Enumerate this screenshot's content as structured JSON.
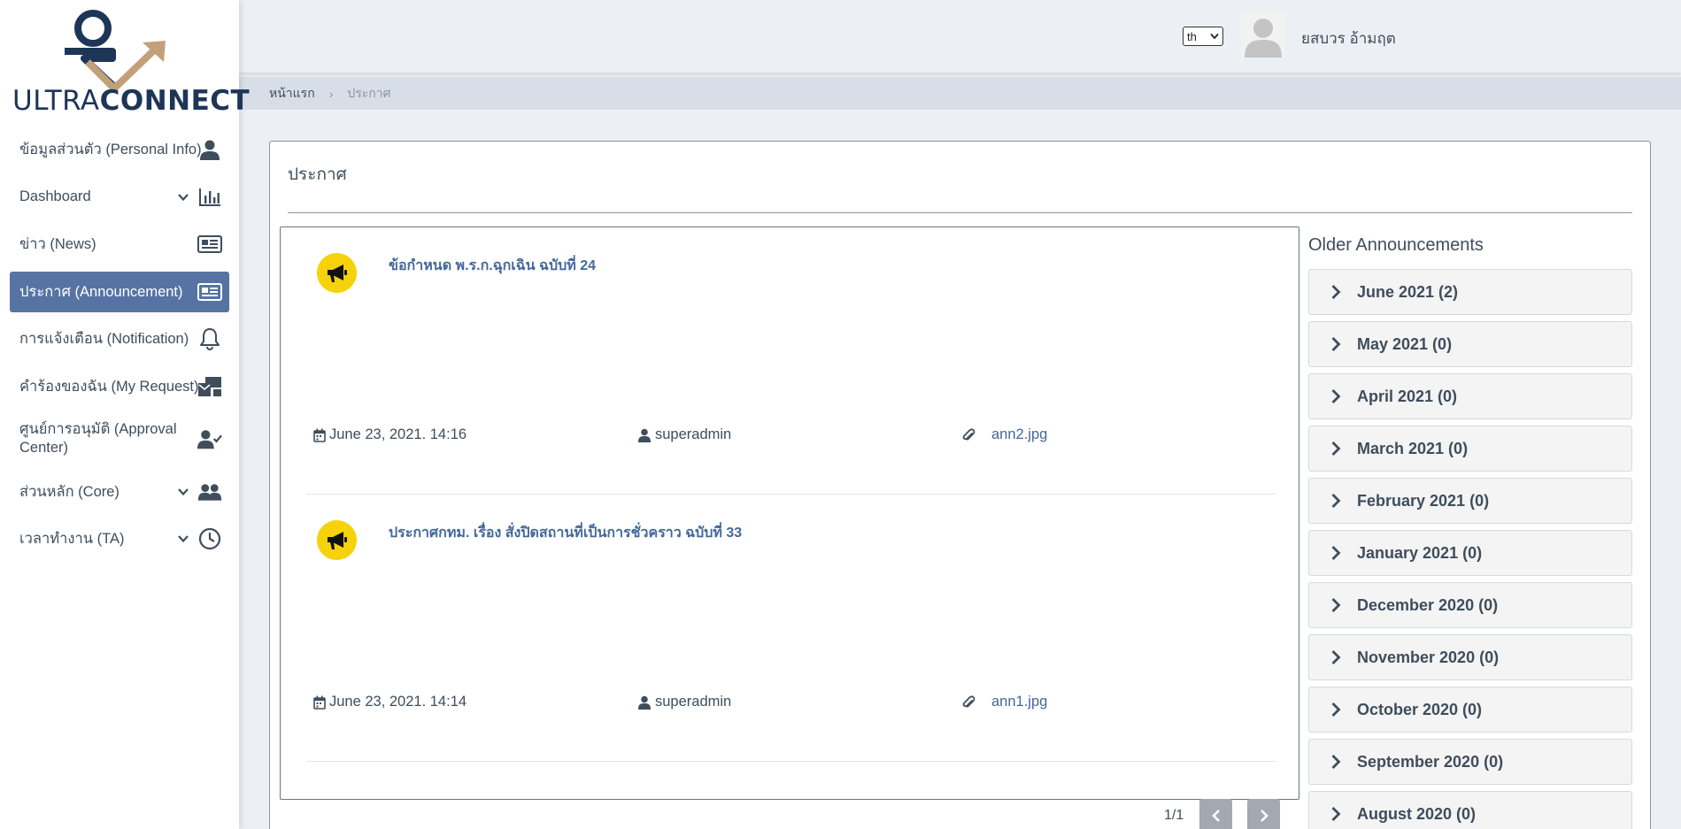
{
  "brand": {
    "part1": "ULTRA",
    "part2": "CONNECT"
  },
  "colors": {
    "accent": "#5673a3",
    "icon_yellow": "#f6d20a",
    "link": "#44689a",
    "logo_navy": "#1d3557",
    "logo_gold": "#c2a07a"
  },
  "sidebar": {
    "items": [
      {
        "label": "ข้อมูลส่วนตัว (Personal Info)",
        "icon": "user-icon"
      },
      {
        "label": "Dashboard",
        "icon": "bar-chart-icon"
      },
      {
        "label": "ข่าว (News)",
        "icon": "newspaper-icon"
      },
      {
        "label": "ประกาศ (Announcement)",
        "icon": "newspaper-icon"
      },
      {
        "label": "การแจ้งเตือน (Notification)",
        "icon": "bell-icon"
      },
      {
        "label": "คำร้องของฉัน (My Request)",
        "icon": "mail-bulk-icon"
      },
      {
        "label": "ศูนย์การอนุมัติ (Approval Center)",
        "icon": "user-check-icon"
      },
      {
        "label": "ส่วนหลัก (Core)",
        "icon": "users-icon"
      },
      {
        "label": "เวลาทำงาน (TA)",
        "icon": "clock-icon"
      }
    ]
  },
  "header": {
    "language": "th",
    "username": "ยสบวร อ้ามฤต"
  },
  "breadcrumb": {
    "home": "หน้าแรก",
    "separator": "›",
    "current": "ประกาศ"
  },
  "page": {
    "title": "ประกาศ"
  },
  "announcements": [
    {
      "title": "ข้อกำหนด พ.ร.ก.ฉุกเฉิน ฉบับที่ 24",
      "date": "June 23, 2021. 14:16",
      "author": "superadmin",
      "file": "ann2.jpg"
    },
    {
      "title": "ประกาศกทม. เรื่อง สั่งปิดสถานที่เป็นการชั่วคราว ฉบับที่ 33",
      "date": "June 23, 2021. 14:14",
      "author": "superadmin",
      "file": "ann1.jpg"
    }
  ],
  "pagination": {
    "label": "1/1"
  },
  "older": {
    "title": "Older Announcements",
    "months": [
      "June 2021 (2)",
      "May 2021 (0)",
      "April 2021 (0)",
      "March 2021 (0)",
      "February 2021 (0)",
      "January 2021 (0)",
      "December 2020 (0)",
      "November 2020 (0)",
      "October 2020 (0)",
      "September 2020 (0)",
      "August 2020 (0)"
    ]
  }
}
